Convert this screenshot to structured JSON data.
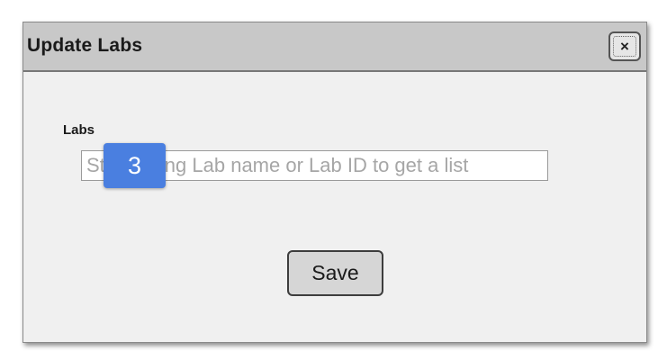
{
  "dialog": {
    "title": "Update Labs",
    "close_glyph": "×",
    "close_icon": "close-icon"
  },
  "form": {
    "labs_label": "Labs",
    "labs_input": {
      "value": "",
      "placeholder": "Start typing Lab name or Lab ID to get a list"
    },
    "save_label": "Save"
  },
  "overlay": {
    "marker_number": "3"
  },
  "colors": {
    "titlebar": "#c8c8c8",
    "dialog_bg": "#f0f0f0",
    "marker": "#4a7fe0"
  }
}
